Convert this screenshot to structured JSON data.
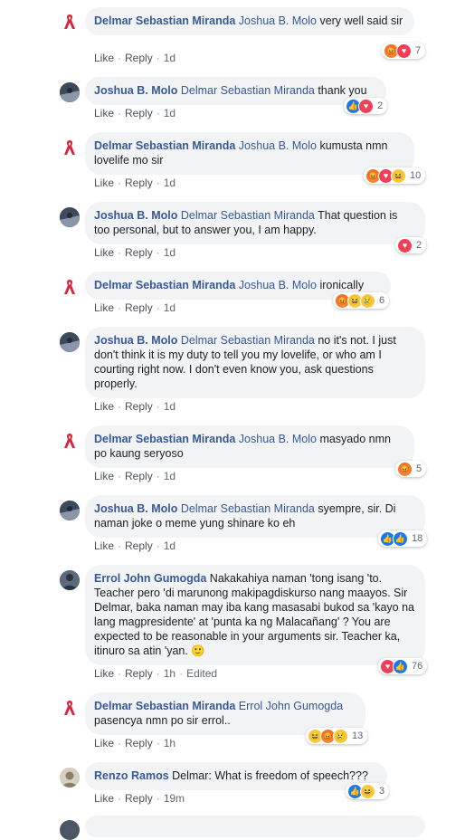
{
  "labels": {
    "like": "Like",
    "reply": "Reply",
    "edited": "Edited"
  },
  "comments": [
    {
      "author": "Delmar Sebastian Miranda",
      "mention": "Joshua B. Molo",
      "text": " very well said sir",
      "time": "1d",
      "reactions": [
        "angry-icon",
        "love-icon"
      ],
      "count": "7"
    },
    {
      "author": "Joshua B. Molo",
      "mention": "Delmar Sebastian Miranda",
      "text": " thank you",
      "time": "1d",
      "reactions": [
        "like-icon",
        "love-icon"
      ],
      "count": "2"
    },
    {
      "author": "Delmar Sebastian Miranda",
      "mention": "Joshua B. Molo",
      "text": " kumusta nmn lovelife mo sir",
      "time": "1d",
      "reactions": [
        "angry-icon",
        "love-icon",
        "haha-icon"
      ],
      "count": "10"
    },
    {
      "author": "Joshua B. Molo",
      "mention": "Delmar Sebastian Miranda",
      "text": " That question is too personal, but to answer you, I am happy.",
      "time": "1d",
      "reactions": [
        "love-icon"
      ],
      "count": "2"
    },
    {
      "author": "Delmar Sebastian Miranda",
      "mention": "Joshua B. Molo",
      "text": " ironically",
      "time": "1d",
      "reactions": [
        "angry-icon",
        "haha-icon",
        "sad-icon"
      ],
      "count": "6"
    },
    {
      "author": "Joshua B. Molo",
      "mention": "Delmar Sebastian Miranda",
      "text": " no it's not. I just don't think it is my duty to tell you my lovelife, or who am I courting right now. I don't even know you, ask questions properly.",
      "time": "1d",
      "reactions": [],
      "count": ""
    },
    {
      "author": "Delmar Sebastian Miranda",
      "mention": "Joshua B. Molo",
      "text": " masyado nmn po kaung seryoso",
      "time": "1d",
      "reactions": [
        "angry-icon"
      ],
      "count": "5"
    },
    {
      "author": "Joshua B. Molo",
      "mention": "Delmar Sebastian Miranda",
      "text": " syempre, sir. Di naman joke o meme yung shinare ko eh",
      "time": "1d",
      "reactions": [
        "like-icon",
        "like-icon"
      ],
      "count": "18"
    },
    {
      "author": "Errol John Gumogda",
      "mention": "",
      "text": " Nakakahiya naman 'tong isang 'to. Teacher pero 'di marunong makipagdiskurso nang maayos. Sir Delmar, baka naman may iba kang masasabi bukod sa 'kayo na lang magpresidente' at 'punta ka ng Malacañang' ? You are expected to be reasonable in your arguments sir. Teacher ka, itinuro sa atin 'yan. 🙂",
      "time": "1h",
      "reactions": [
        "love-icon",
        "like-icon"
      ],
      "count": "76"
    },
    {
      "author": "Delmar Sebastian Miranda",
      "mention": "Errol John Gumogda",
      "text": " pasencya nmn po sir errol..",
      "time": "1h",
      "reactions": [
        "haha-icon",
        "angry-icon",
        "sad-icon"
      ],
      "count": "13"
    },
    {
      "author": "Renzo Ramos",
      "mention": "",
      "text": " Delmar: What is freedom of speech???",
      "time": "19m",
      "reactions": [
        "like-icon",
        "haha-icon"
      ],
      "count": "3"
    }
  ]
}
